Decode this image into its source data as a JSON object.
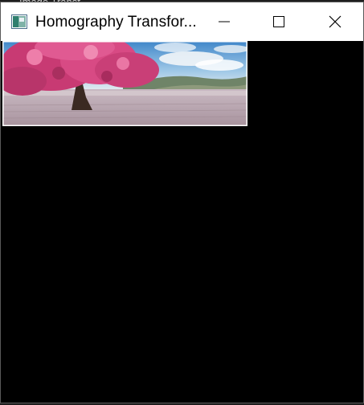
{
  "background_window": {
    "title_peek": "Image Transf"
  },
  "window": {
    "title": "Homography Transfor...",
    "icon": "image-viewer-icon",
    "controls": {
      "minimize_icon": "minimize-icon",
      "maximize_icon": "maximize-icon",
      "close_icon": "close-icon"
    }
  },
  "canvas": {
    "background": "#000000",
    "image": {
      "subject": "pink blossom tree landscape",
      "icon": "warped-image"
    }
  },
  "colors": {
    "titlebar": "#ffffff",
    "title_text": "#000000",
    "canvas_bg": "#000000",
    "blossom_pink": "#d6407a",
    "sky_blue": "#5d9ed4",
    "ground": "#b9aab2"
  }
}
